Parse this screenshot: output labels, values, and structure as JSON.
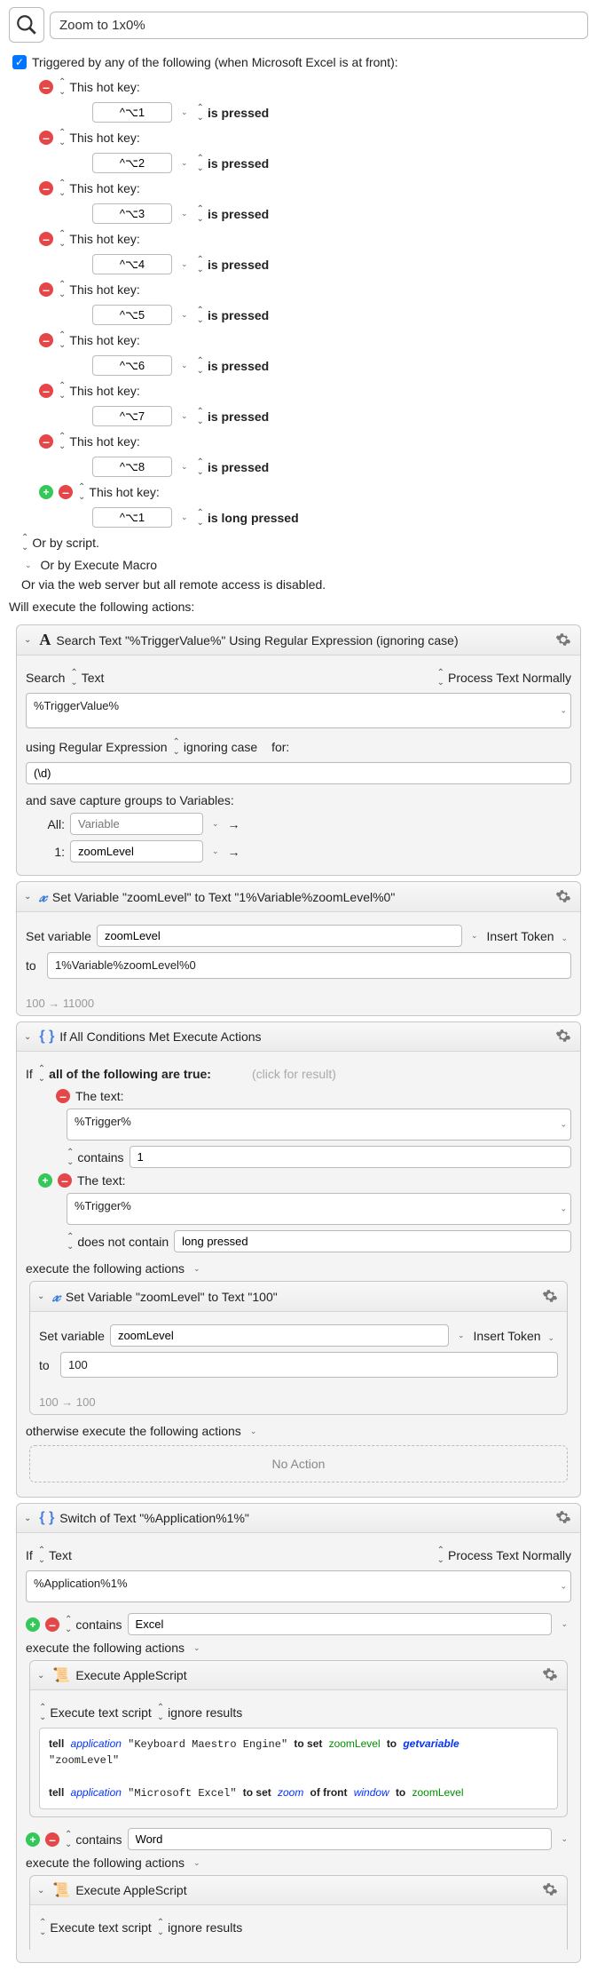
{
  "title": "Zoom to 1x0%",
  "trigger_label": "Triggered by any of the following (when Microsoft Excel is at front):",
  "hotkeys": [
    {
      "label": "This hot key:",
      "shortcut": "^⌥1",
      "action": "is pressed",
      "has_add": false
    },
    {
      "label": "This hot key:",
      "shortcut": "^⌥2",
      "action": "is pressed",
      "has_add": false
    },
    {
      "label": "This hot key:",
      "shortcut": "^⌥3",
      "action": "is pressed",
      "has_add": false
    },
    {
      "label": "This hot key:",
      "shortcut": "^⌥4",
      "action": "is pressed",
      "has_add": false
    },
    {
      "label": "This hot key:",
      "shortcut": "^⌥5",
      "action": "is pressed",
      "has_add": false
    },
    {
      "label": "This hot key:",
      "shortcut": "^⌥6",
      "action": "is pressed",
      "has_add": false
    },
    {
      "label": "This hot key:",
      "shortcut": "^⌥7",
      "action": "is pressed",
      "has_add": false
    },
    {
      "label": "This hot key:",
      "shortcut": "^⌥8",
      "action": "is pressed",
      "has_add": false
    },
    {
      "label": "This hot key:",
      "shortcut": "^⌥1",
      "action": "is long pressed",
      "has_add": true
    }
  ],
  "or_script": "Or by script.",
  "or_execute": "Or by Execute Macro",
  "or_web": "Or via the web server but all remote access is disabled.",
  "will_execute": "Will execute the following actions:",
  "search_action": {
    "title": "Search Text \"%TriggerValue%\" Using Regular Expression (ignoring case)",
    "search_label": "Search",
    "text_label": "Text",
    "process_label": "Process Text Normally",
    "text_value": "%TriggerValue%",
    "using_label": "using Regular Expression",
    "case_label": "ignoring case",
    "for_label": "for:",
    "regex_value": "(\\d)",
    "save_label": "and save capture groups to Variables:",
    "all_label": "All:",
    "all_placeholder": "Variable",
    "one_label": "1:",
    "one_value": "zoomLevel"
  },
  "setvar_action": {
    "title": "Set Variable \"zoomLevel\" to Text \"1%Variable%zoomLevel%0\"",
    "setvar_label": "Set variable",
    "var_name": "zoomLevel",
    "insert_token": "Insert Token",
    "to_label": "to",
    "to_value": "1%Variable%zoomLevel%0",
    "footer": "100 → 11000"
  },
  "if_action": {
    "title": "If All Conditions Met Execute Actions",
    "if_label": "If",
    "all_label": "all of the following are true:",
    "hint": "(click for result)",
    "text_label": "The text:",
    "trigger_value": "%Trigger%",
    "contains_label": "contains",
    "contains_value": "1",
    "not_contain_label": "does not contain",
    "not_contain_value": "long pressed",
    "exec_label": "execute the following actions",
    "otherwise_label": "otherwise execute the following actions",
    "no_action": "No Action",
    "nested_title": "Set Variable \"zoomLevel\" to Text \"100\"",
    "nested_var": "zoomLevel",
    "nested_val": "100",
    "nested_footer": "100 → 100"
  },
  "switch_action": {
    "title": "Switch of Text \"%Application%1%\"",
    "if_label": "If",
    "text_label": "Text",
    "process_label": "Process Text Normally",
    "app_value": "%Application%1%",
    "contains_label": "contains",
    "excel_value": "Excel",
    "word_value": "Word",
    "exec_label": "execute the following actions",
    "applescript_title": "Execute AppleScript",
    "execute_script_label": "Execute text script",
    "ignore_results": "ignore results"
  }
}
